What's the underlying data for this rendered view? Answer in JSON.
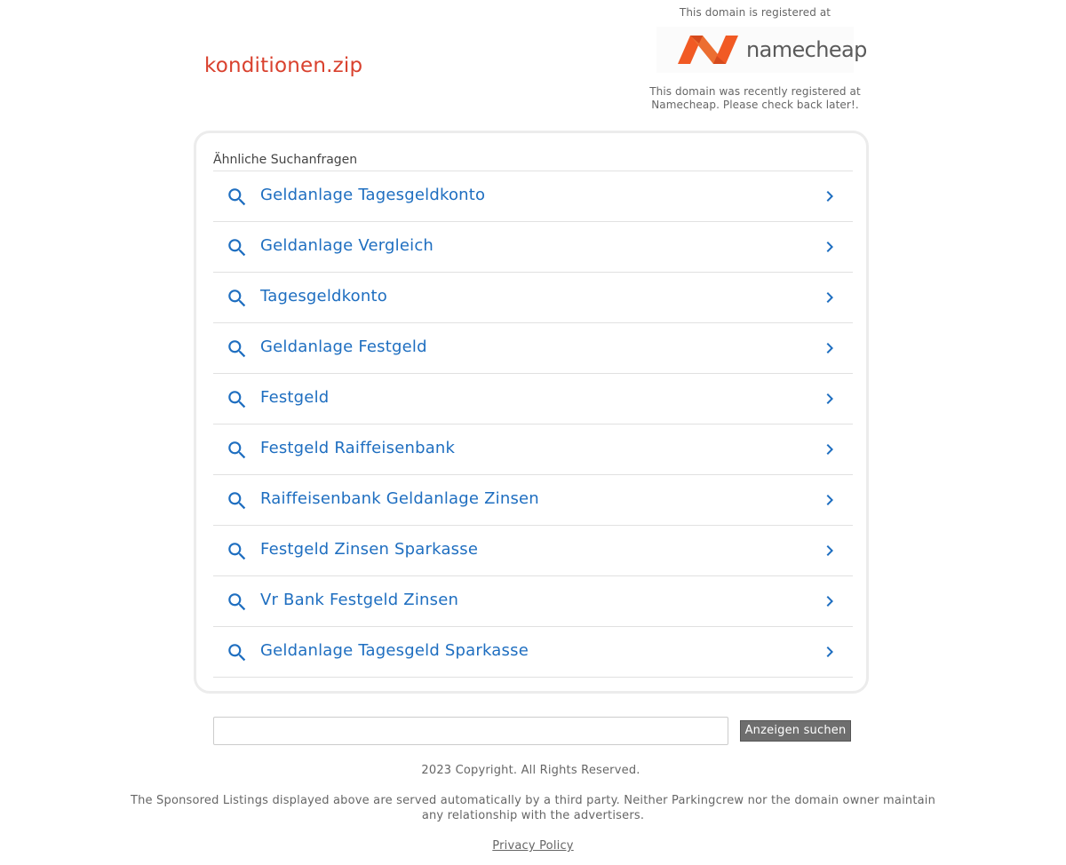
{
  "header": {
    "domain_name": "konditionen.zip",
    "registrar_intro": "This domain is registered at",
    "registrar_brand": "namecheap",
    "registrar_note": "This domain was recently registered at Namecheap. Please check back later!.",
    "logo_colors": [
      "#f15a24",
      "#ec6e31",
      "#d54a1d"
    ]
  },
  "related": {
    "heading": "Ähnliche Suchanfragen",
    "items": [
      {
        "label": "Geldanlage Tagesgeldkonto",
        "icon": "search-icon",
        "action_icon": "chevron-right-icon"
      },
      {
        "label": "Geldanlage Vergleich",
        "icon": "search-icon",
        "action_icon": "chevron-right-icon"
      },
      {
        "label": "Tagesgeldkonto",
        "icon": "search-icon",
        "action_icon": "chevron-right-icon"
      },
      {
        "label": "Geldanlage Festgeld",
        "icon": "search-icon",
        "action_icon": "chevron-right-icon"
      },
      {
        "label": "Festgeld",
        "icon": "search-icon",
        "action_icon": "chevron-right-icon"
      },
      {
        "label": "Festgeld Raiffeisenbank",
        "icon": "search-icon",
        "action_icon": "chevron-right-icon"
      },
      {
        "label": "Raiffeisenbank Geldanlage Zinsen",
        "icon": "search-icon",
        "action_icon": "chevron-right-icon"
      },
      {
        "label": "Festgeld Zinsen Sparkasse",
        "icon": "search-icon",
        "action_icon": "chevron-right-icon"
      },
      {
        "label": "Vr Bank Festgeld Zinsen",
        "icon": "search-icon",
        "action_icon": "chevron-right-icon"
      },
      {
        "label": "Geldanlage Tagesgeld Sparkasse",
        "icon": "search-icon",
        "action_icon": "chevron-right-icon"
      }
    ],
    "link_color": "#1e6ec0"
  },
  "search": {
    "value": "",
    "placeholder": "",
    "button_label": "Anzeigen suchen"
  },
  "footer": {
    "copyright": "2023 Copyright. All Rights Reserved.",
    "disclaimer": "The Sponsored Listings displayed above are served automatically by a third party. Neither Parkingcrew nor the domain owner maintain any relationship with the advertisers.",
    "privacy_label": "Privacy Policy"
  },
  "colors": {
    "domain_title": "#d9412e",
    "text_muted": "#666666",
    "button_bg": "#6e6e6e"
  }
}
